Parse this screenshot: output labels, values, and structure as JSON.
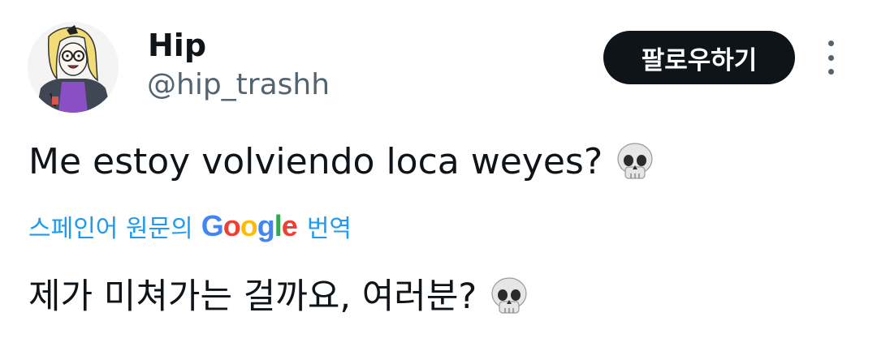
{
  "user": {
    "name": "Hip",
    "handle": "@hip_trashh"
  },
  "follow_label": "팔로우하기",
  "tweet": {
    "text": "Me estoy volviendo loca weyes?",
    "emoji": "skull"
  },
  "translation": {
    "link_prefix": "스페인어 원문의",
    "brand": [
      "G",
      "o",
      "o",
      "g",
      "l",
      "e"
    ],
    "link_suffix": "번역",
    "translated_text": "제가 미쳐가는 걸까요, 여러분?"
  },
  "colors": {
    "link": "#1d9bf0",
    "text": "#0f1419",
    "secondary": "#536471",
    "button_bg": "#0f1419"
  }
}
